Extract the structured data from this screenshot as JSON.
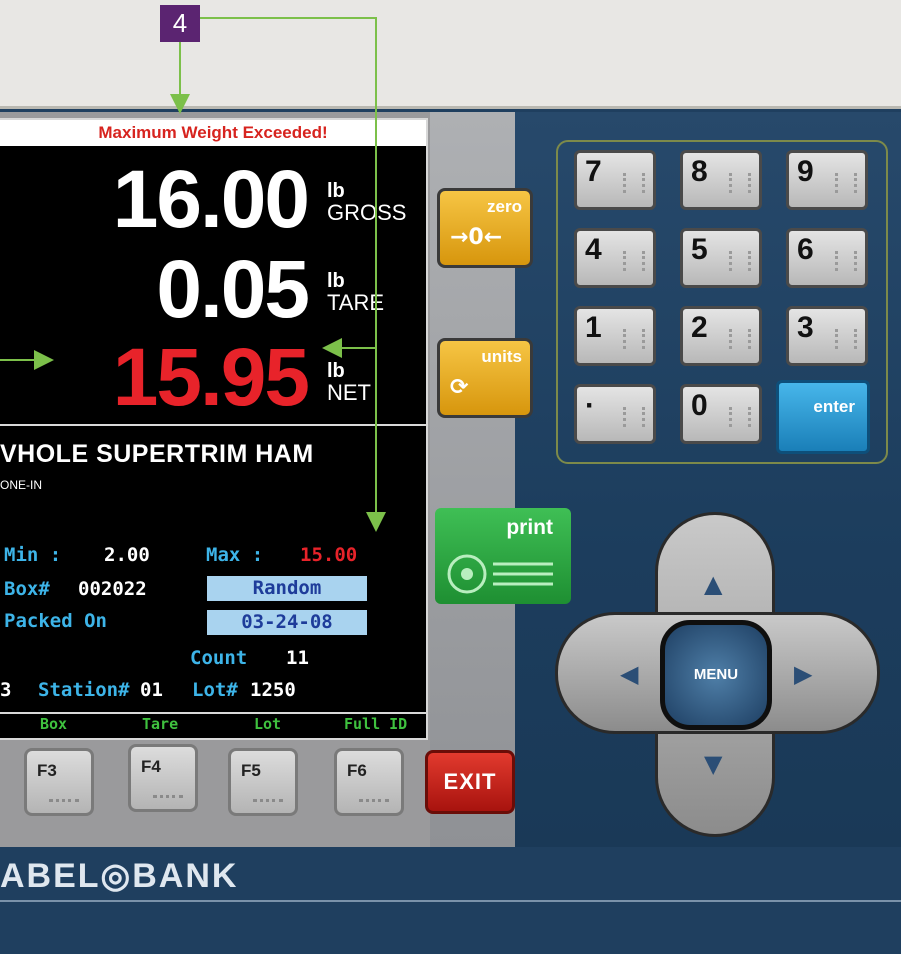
{
  "callout": {
    "number": "4"
  },
  "screen": {
    "alert": "Maximum Weight Exceeded!",
    "gross": {
      "value": "16.00",
      "unit": "lb",
      "label": "GROSS"
    },
    "tare": {
      "value": "0.05",
      "unit": "lb",
      "label": "TARE"
    },
    "net": {
      "value": "15.95",
      "unit": "lb",
      "label": "NET"
    },
    "product_name": "VHOLE SUPERTRIM HAM",
    "product_sub": "ONE-IN",
    "min_label": "Min :",
    "min_value": "2.00",
    "max_label": "Max :",
    "max_value": "15.00",
    "box_label": "Box#",
    "box_value": "002022",
    "box_mode": "Random",
    "packed_label": "Packed On",
    "packed_value": "03-24-08",
    "count_label": "Count",
    "count_value": "11",
    "station_prefix": "3",
    "station_label": "Station#",
    "station_value": "01",
    "lot_label": "Lot#",
    "lot_value": "1250",
    "softkeys": [
      "Box",
      "Tare",
      "Lot",
      "Full ID"
    ]
  },
  "function_keys": [
    "F3",
    "F4",
    "F5",
    "F6"
  ],
  "exit_label": "EXIT",
  "side_buttons": {
    "zero": "zero",
    "zero_icon": "→0←",
    "units": "units",
    "print": "print"
  },
  "keypad": [
    "7",
    "8",
    "9",
    "4",
    "5",
    "6",
    "1",
    "2",
    "3",
    "·",
    "0",
    "enter"
  ],
  "menu_label": "MENU",
  "logo": "ABEL◎BANK",
  "colors": {
    "alert": "#d7241f",
    "net": "#e8232a",
    "label_cyan": "#3db4e8",
    "callout": "#5b2471",
    "callout_line": "#7cc04a"
  }
}
